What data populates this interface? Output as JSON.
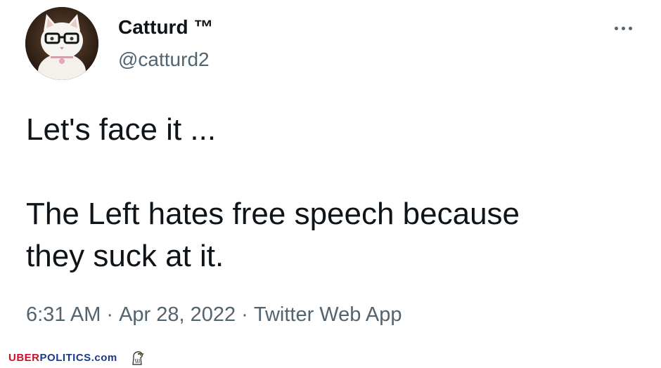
{
  "author": {
    "display_name": "Catturd ™",
    "handle": "@catturd2",
    "avatar_icon": "cat-with-glasses-avatar"
  },
  "menu": {
    "icon": "more-dots-icon"
  },
  "tweet": {
    "lines": [
      "Let's face it ...",
      "The Left hates free speech because",
      "they suck at it."
    ]
  },
  "meta": {
    "time": "6:31 AM",
    "separator": "·",
    "date": "Apr 28, 2022",
    "source": "Twitter Web App"
  },
  "watermark": {
    "part1": "UBER",
    "part2": "POLITICS",
    "part3": ".com",
    "icon": "eagle-icon",
    "colors": {
      "red": "#c8102e",
      "blue": "#1a3a8a"
    }
  }
}
